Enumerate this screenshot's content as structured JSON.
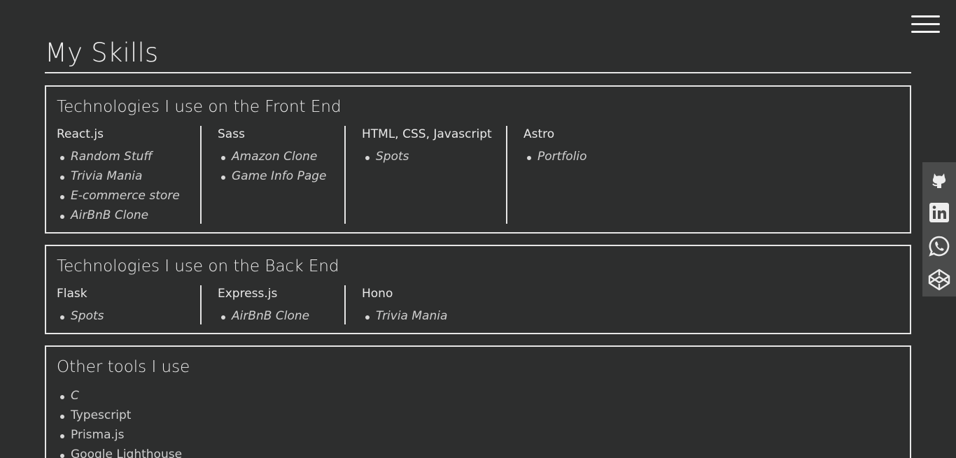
{
  "page": {
    "title": "My Skills"
  },
  "header": {
    "menu_icon": "hamburger-menu-icon"
  },
  "frontend": {
    "heading": "Technologies I use on the Front End",
    "columns": [
      {
        "title": "React.js",
        "items": [
          "Random Stuff",
          "Trivia Mania",
          "E-commerce store",
          "AirBnB Clone"
        ]
      },
      {
        "title": "Sass",
        "items": [
          "Amazon Clone",
          "Game Info Page"
        ]
      },
      {
        "title": "HTML, CSS, Javascript",
        "items": [
          "Spots"
        ]
      },
      {
        "title": "Astro",
        "items": [
          "Portfolio"
        ]
      }
    ]
  },
  "backend": {
    "heading": "Technologies I use on the Back End",
    "columns": [
      {
        "title": "Flask",
        "items": [
          "Spots"
        ]
      },
      {
        "title": "Express.js",
        "items": [
          "AirBnB Clone"
        ]
      },
      {
        "title": "Hono",
        "items": [
          "Trivia Mania"
        ]
      }
    ]
  },
  "other": {
    "heading": "Other tools I use",
    "items": [
      "C",
      "Typescript",
      "Prisma.js",
      "Google Lighthouse"
    ]
  },
  "social": {
    "icons": [
      "github-icon",
      "linkedin-icon",
      "whatsapp-icon",
      "codepen-icon"
    ]
  },
  "colors": {
    "background": "#2d2e2e",
    "border": "#e6e6e6",
    "text": "#e6e6e6",
    "social_bar": "#4a4b4b"
  }
}
